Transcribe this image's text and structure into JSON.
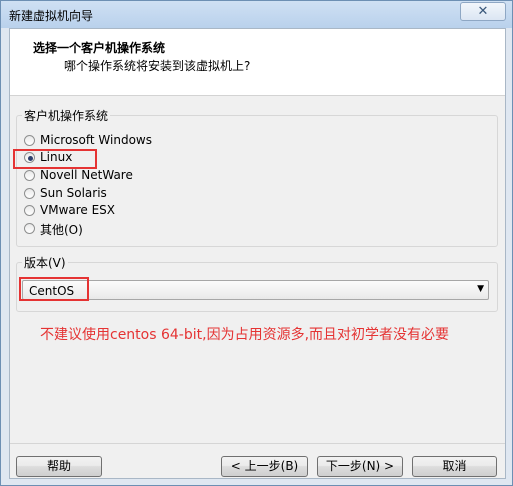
{
  "window": {
    "title": "新建虚拟机向导"
  },
  "header": {
    "title": "选择一个客户机操作系统",
    "subtitle": "哪个操作系统将安装到该虚拟机上?"
  },
  "os_group": {
    "label": "客户机操作系统",
    "options": [
      {
        "label": "Microsoft Windows",
        "selected": false
      },
      {
        "label": "Linux",
        "selected": true
      },
      {
        "label": "Novell NetWare",
        "selected": false
      },
      {
        "label": "Sun Solaris",
        "selected": false
      },
      {
        "label": "VMware ESX",
        "selected": false
      },
      {
        "label": "其他(O)",
        "selected": false
      }
    ]
  },
  "version_group": {
    "label": "版本(V)",
    "selected": "CentOS"
  },
  "annotation": "不建议使用centos 64-bit,因为占用资源多,而且对初学者没有必要",
  "buttons": {
    "help": "帮助",
    "back": "< 上一步(B)",
    "next": "下一步(N) >",
    "cancel": "取消"
  },
  "colors": {
    "highlight": "#e53333",
    "selected_dot": "#2d3f6d"
  }
}
